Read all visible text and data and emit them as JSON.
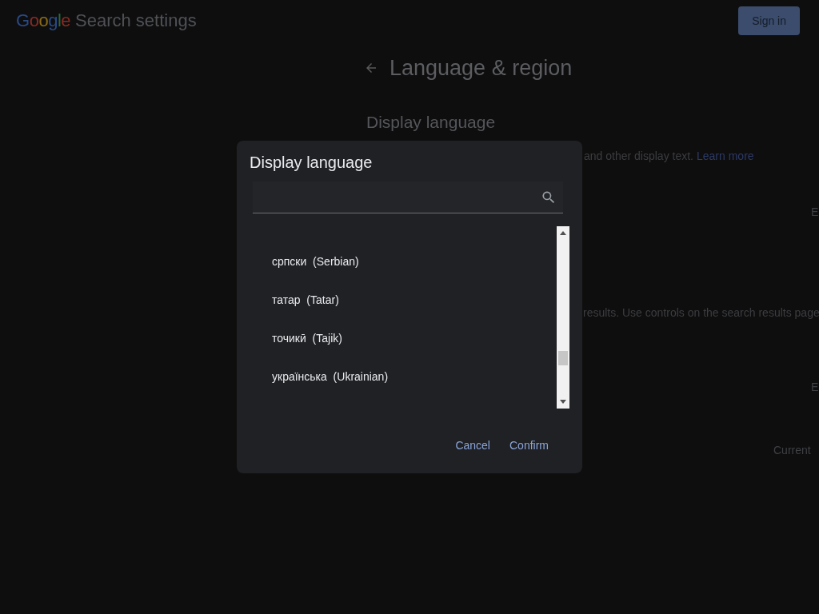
{
  "header": {
    "logo": "Google",
    "title": "Search settings",
    "sign_in": "Sign in"
  },
  "page": {
    "title": "Language & region",
    "section_title": "Display language",
    "description_fragment": "and other display text.",
    "learn_more": "Learn more",
    "value_fragment_1": "E",
    "results_fragment": "results. Use controls on the search results page",
    "value_fragment_2": "E",
    "value_fragment_3": "Current"
  },
  "dialog": {
    "title": "Display language",
    "languages": [
      {
        "label": "српски  (Serbian)"
      },
      {
        "label": "татар  (Tatar)"
      },
      {
        "label": "точикӣ  (Tajik)"
      },
      {
        "label": "українська  (Ukrainian)"
      }
    ],
    "buttons": [
      {
        "label": "Cancel"
      },
      {
        "label": "Confirm"
      }
    ]
  }
}
